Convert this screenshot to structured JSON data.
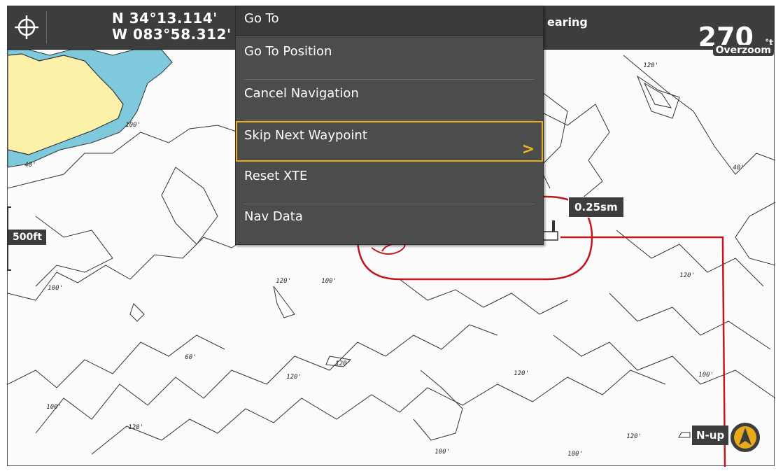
{
  "status_bar": {
    "latitude": "N 34°13.114'",
    "longitude": "W 083°58.312'",
    "bearing_label": "earing",
    "heading_value": "270",
    "heading_unit": "°t",
    "zoom_mode": "Overzoom"
  },
  "menu": {
    "title": "Go To",
    "items": [
      {
        "label": "Go To Position"
      },
      {
        "label": "Cancel Navigation"
      },
      {
        "label": "Skip Next Waypoint",
        "selected": true,
        "arrow": ">"
      },
      {
        "label": "Reset XTE"
      },
      {
        "label": "Nav Data"
      }
    ],
    "highlight_color": "#e8a91a"
  },
  "map": {
    "scale_label": "500ft",
    "distance_label": "0.25sm",
    "orientation_label": "N-up",
    "route_color": "#c01820",
    "land_color": "#fbf1a8",
    "water_color": "#7ec9dc",
    "depth_labels": [
      "120'",
      "40'",
      "40'",
      "100'",
      "120'",
      "100'",
      "120'",
      "60'",
      "120'",
      "120'",
      "120'",
      "100'",
      "100'",
      "120'",
      "100'",
      "100'",
      "120'",
      "100'"
    ]
  },
  "icons": [
    "crosshair-icon",
    "compass-icon",
    "boat-icon",
    "chevron-right-icon"
  ]
}
